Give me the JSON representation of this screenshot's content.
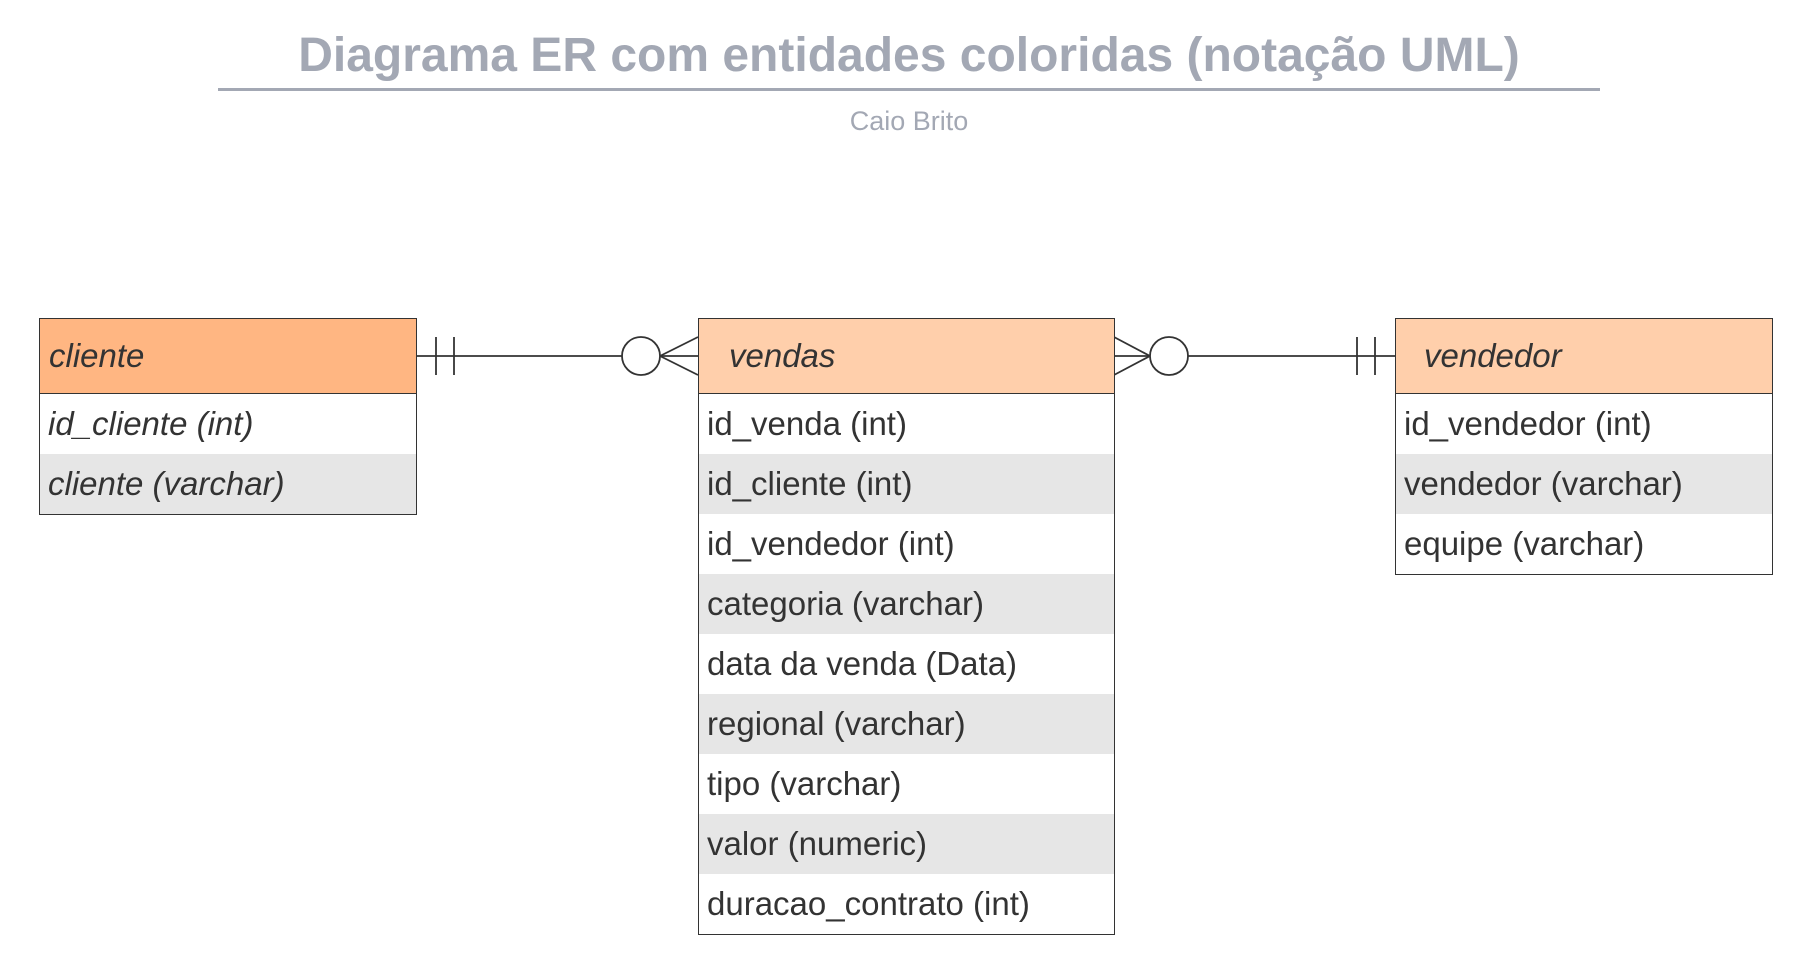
{
  "diagram": {
    "title": "Diagrama ER com entidades coloridas (notação UML)",
    "author": "Caio Brito"
  },
  "colors": {
    "title_gray": "#a3a8b4",
    "cliente_header": "#ffb682",
    "vendas_header": "#ffcfab",
    "vendedor_header": "#ffcfab",
    "row_alt": "#e6e6e6",
    "border": "#333333"
  },
  "entities": {
    "cliente": {
      "name": "cliente",
      "attributes": [
        "id_cliente (int)",
        "cliente (varchar)"
      ]
    },
    "vendas": {
      "name": "vendas",
      "attributes": [
        "id_venda (int)",
        "id_cliente (int)",
        "id_vendedor (int)",
        "categoria (varchar)",
        "data da venda (Data)",
        "regional (varchar)",
        "tipo (varchar)",
        "valor (numeric)",
        "duracao_contrato (int)"
      ]
    },
    "vendedor": {
      "name": "vendedor",
      "attributes": [
        "id_vendedor (int)",
        "vendedor (varchar)",
        "equipe (varchar)"
      ]
    }
  },
  "relationships": [
    {
      "from": "cliente",
      "from_cardinality": "exactly-one",
      "to": "vendas",
      "to_cardinality": "zero-or-many"
    },
    {
      "from": "vendedor",
      "from_cardinality": "exactly-one",
      "to": "vendas",
      "to_cardinality": "zero-or-many"
    }
  ]
}
